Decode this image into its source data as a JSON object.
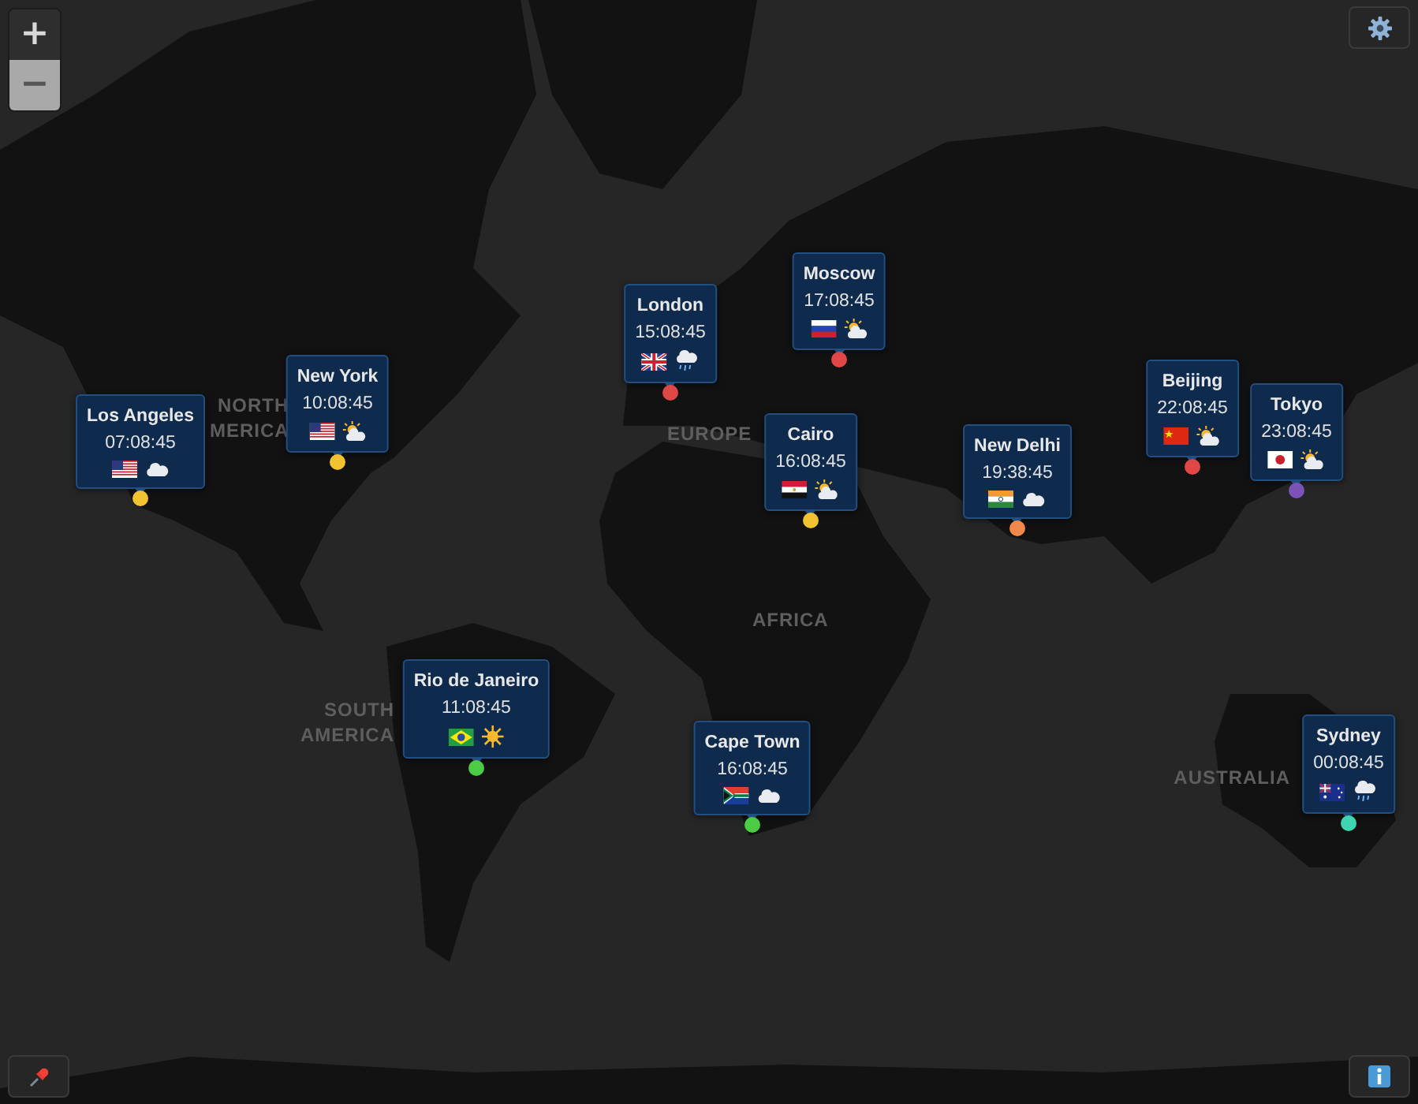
{
  "zoom_controls": {
    "zoom_in": {
      "label": "+",
      "disabled": false
    },
    "zoom_out": {
      "label": "−",
      "disabled": true
    }
  },
  "map_labels": [
    {
      "text": "NORTH"
    },
    {
      "text": "MERICA"
    },
    {
      "text": "EUROPE"
    },
    {
      "text": "AFRICA"
    },
    {
      "text": "SOUTH"
    },
    {
      "text": "AMERICA"
    },
    {
      "text": "AUSTRALIA"
    }
  ],
  "cities": [
    {
      "name": "Los Angeles",
      "time": "07:08:45",
      "flag": {
        "kind": "us"
      },
      "weather": {
        "kind": "cloud"
      },
      "color": "#f2c230"
    },
    {
      "name": "New York",
      "time": "10:08:45",
      "flag": {
        "kind": "us"
      },
      "weather": {
        "kind": "partly"
      },
      "color": "#f2c230"
    },
    {
      "name": "London",
      "time": "15:08:45",
      "flag": {
        "kind": "gb"
      },
      "weather": {
        "kind": "rain"
      },
      "color": "#e04848"
    },
    {
      "name": "Moscow",
      "time": "17:08:45",
      "flag": {
        "kind": "ru"
      },
      "weather": {
        "kind": "partly"
      },
      "color": "#e04848"
    },
    {
      "name": "Cairo",
      "time": "16:08:45",
      "flag": {
        "kind": "eg"
      },
      "weather": {
        "kind": "partly"
      },
      "color": "#f2c230"
    },
    {
      "name": "New Delhi",
      "time": "19:38:45",
      "flag": {
        "kind": "in"
      },
      "weather": {
        "kind": "cloud"
      },
      "color": "#f0884a"
    },
    {
      "name": "Beijing",
      "time": "22:08:45",
      "flag": {
        "kind": "cn"
      },
      "weather": {
        "kind": "partly"
      },
      "color": "#e04848"
    },
    {
      "name": "Tokyo",
      "time": "23:08:45",
      "flag": {
        "kind": "jp"
      },
      "weather": {
        "kind": "partly"
      },
      "color": "#7b52b8"
    },
    {
      "name": "Rio de Janeiro",
      "time": "11:08:45",
      "flag": {
        "kind": "br"
      },
      "weather": {
        "kind": "sun"
      },
      "color": "#4ccc44"
    },
    {
      "name": "Cape Town",
      "time": "16:08:45",
      "flag": {
        "kind": "za"
      },
      "weather": {
        "kind": "cloud"
      },
      "color": "#4ccc44"
    },
    {
      "name": "Sydney",
      "time": "00:08:45",
      "flag": {
        "kind": "au"
      },
      "weather": {
        "kind": "rain"
      },
      "color": "#3dd6b0"
    }
  ]
}
